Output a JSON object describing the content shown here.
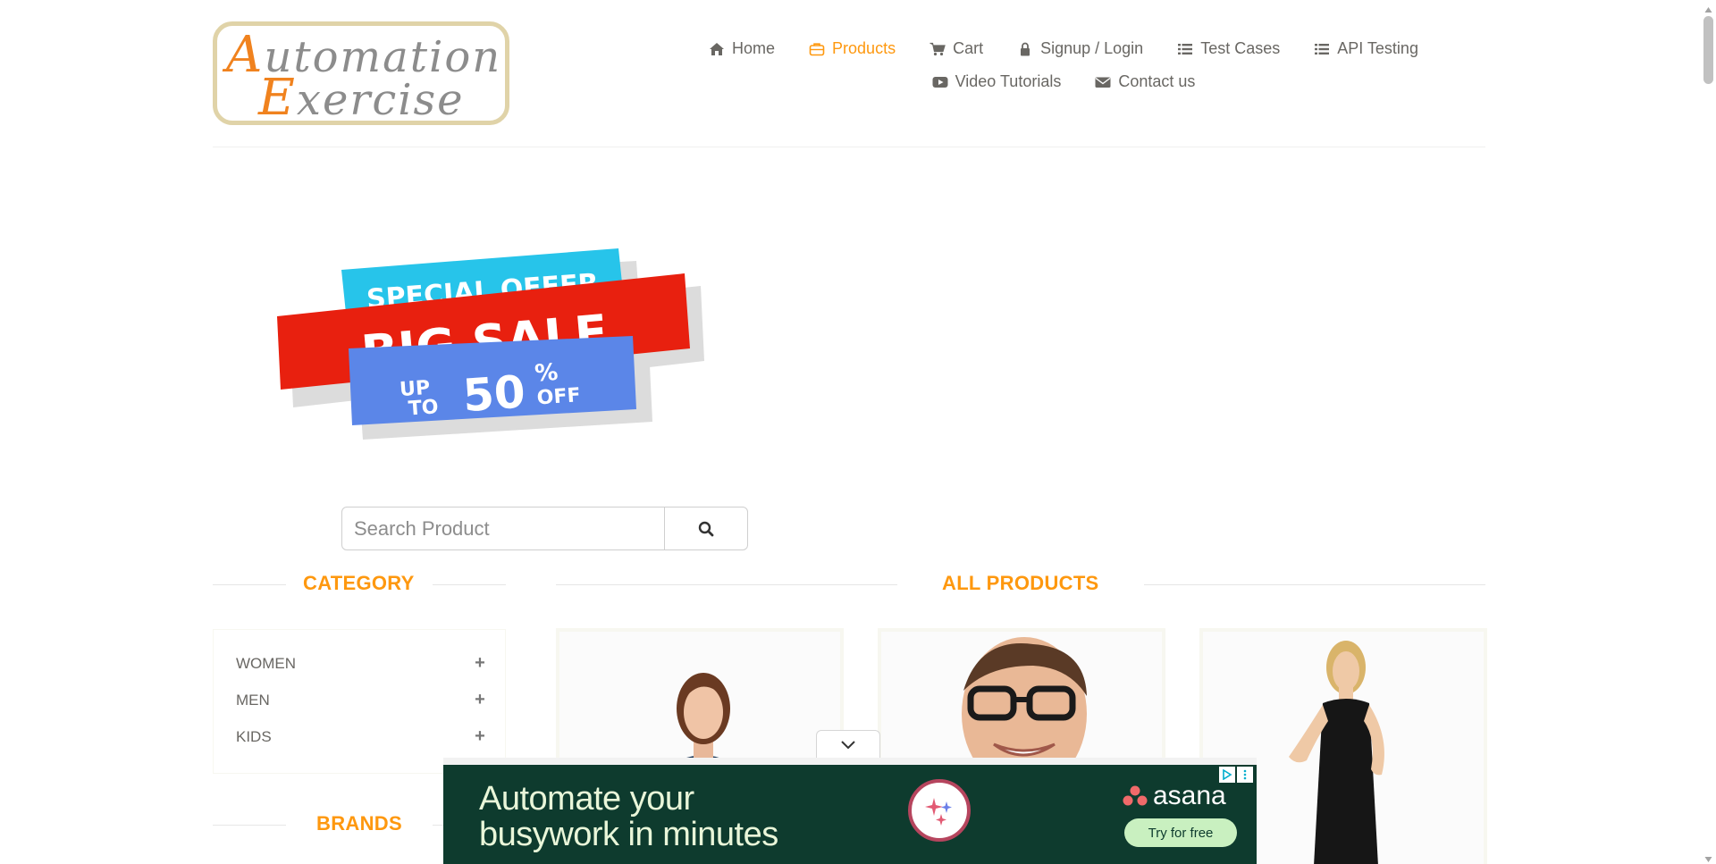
{
  "logo": {
    "line1_cap": "A",
    "line1_rest": "utomation",
    "line2_cap": "E",
    "line2_rest": "xercise"
  },
  "nav": {
    "row1": [
      {
        "label": "Home",
        "icon": "home-icon"
      },
      {
        "label": "Products",
        "icon": "briefcase-icon",
        "active": true
      },
      {
        "label": "Cart",
        "icon": "cart-icon"
      },
      {
        "label": "Signup / Login",
        "icon": "lock-icon"
      },
      {
        "label": "Test Cases",
        "icon": "list-icon"
      },
      {
        "label": "API Testing",
        "icon": "list-icon"
      }
    ],
    "row2": [
      {
        "label": "Video Tutorials",
        "icon": "youtube-play-icon"
      },
      {
        "label": "Contact us",
        "icon": "envelope-icon"
      }
    ]
  },
  "banner": {
    "line1": "SPECIAL OFFER",
    "line2": "BIG SALE",
    "up": "UP",
    "to": "TO",
    "pct_value": "50",
    "pct_sign": "%",
    "off": "OFF"
  },
  "search": {
    "placeholder": "Search Product",
    "button_icon": "search-icon"
  },
  "category": {
    "title": "CATEGORY",
    "items": [
      {
        "label": "WOMEN"
      },
      {
        "label": "MEN"
      },
      {
        "label": "KIDS"
      }
    ]
  },
  "brands": {
    "title": "BRANDS"
  },
  "products": {
    "title": "ALL PRODUCTS"
  },
  "ad": {
    "headline_line1": "Automate your",
    "headline_line2": "busywork in minutes",
    "brand": "asana",
    "cta": "Try for free"
  },
  "colors": {
    "accent": "#fe980f",
    "text": "#696763",
    "ad_bg": "#0e3b2e",
    "ad_cta": "#c9f0c0"
  }
}
